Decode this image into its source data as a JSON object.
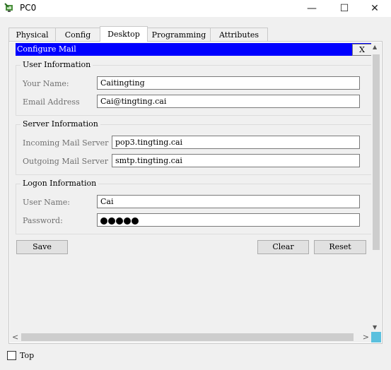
{
  "window": {
    "title": "PC0",
    "minimize": "—",
    "maximize": "☐",
    "close": "✕"
  },
  "tabs": [
    "Physical",
    "Config",
    "Desktop",
    "Programming",
    "Attributes"
  ],
  "active_tab": "Desktop",
  "panel": {
    "title": "Configure Mail",
    "close_label": "X"
  },
  "user_info": {
    "legend": "User Information",
    "name_label": "Your Name:",
    "name_value": "Caitingting",
    "email_label": "Email Address",
    "email_value": "Cai@tingting.cai"
  },
  "server_info": {
    "legend": "Server Information",
    "incoming_label": "Incoming Mail Server",
    "incoming_value": "pop3.tingting.cai",
    "outgoing_label": "Outgoing Mail Server",
    "outgoing_value": "smtp.tingting.cai"
  },
  "logon_info": {
    "legend": "Logon Information",
    "username_label": "User Name:",
    "username_value": "Cai",
    "password_label": "Password:",
    "password_length": 5
  },
  "buttons": {
    "save": "Save",
    "clear": "Clear",
    "reset": "Reset"
  },
  "scroll": {
    "up": "▲",
    "down": "▼",
    "left": "<",
    "right": ">"
  },
  "footer": {
    "top_label": "Top",
    "top_checked": false
  }
}
